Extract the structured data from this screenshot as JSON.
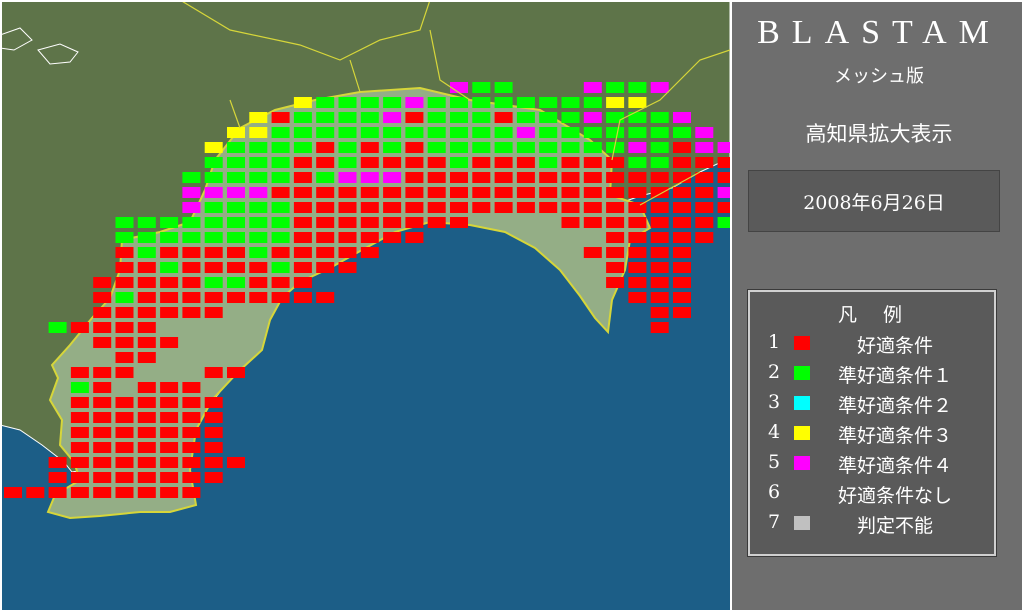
{
  "app": {
    "title": "BLASTAM",
    "subtitle": "メッシュ版",
    "view_label": "高知県拡大表示",
    "date": "2008年6月26日"
  },
  "colors": {
    "sea": "#1c5e87",
    "land": "#5e7449",
    "prefecture": "#94ae86",
    "border": "#d6d63a",
    "coast": "#ffffff"
  },
  "legend": {
    "title": "凡例",
    "items": [
      {
        "num": "1",
        "color": "#ff0000",
        "label": "好適条件"
      },
      {
        "num": "2",
        "color": "#00ff00",
        "label": "準好適条件１"
      },
      {
        "num": "3",
        "color": "#00ffff",
        "label": "準好適条件２"
      },
      {
        "num": "4",
        "color": "#ffff00",
        "label": "準好適条件３"
      },
      {
        "num": "5",
        "color": "#ff00ff",
        "label": "準好適条件４"
      },
      {
        "num": "6",
        "color": "",
        "label": "好適条件なし"
      },
      {
        "num": "7",
        "color": "#c0c0c0",
        "label": "判定不能"
      }
    ]
  }
}
